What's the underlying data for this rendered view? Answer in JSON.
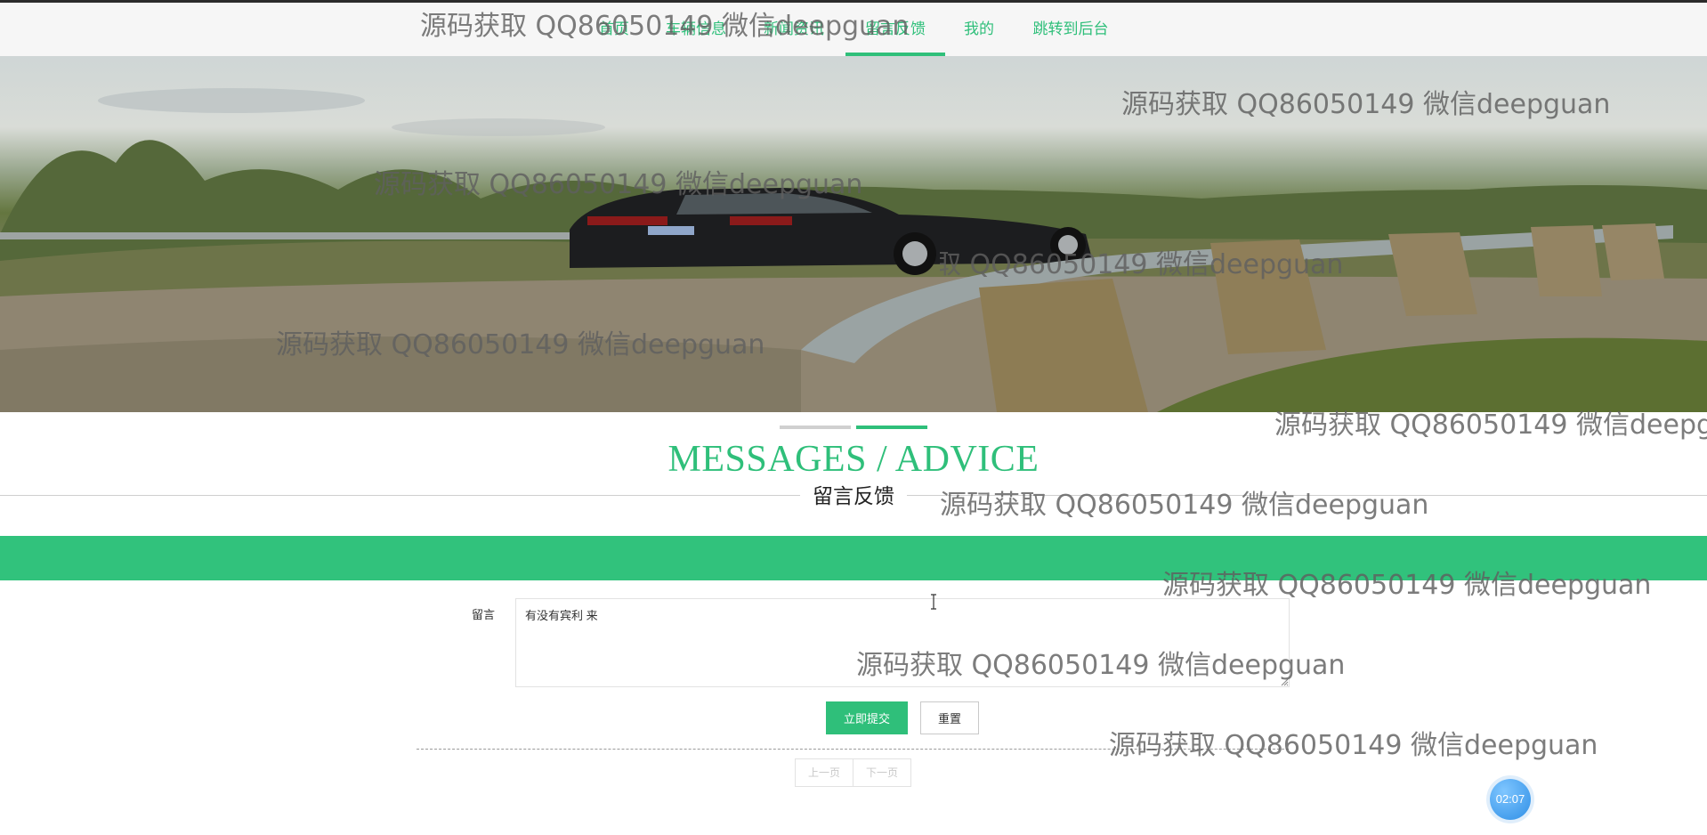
{
  "nav": {
    "items": [
      {
        "label": "首页"
      },
      {
        "label": "车辆信息"
      },
      {
        "label": "新闻资讯"
      },
      {
        "label": "留言反馈",
        "active": true
      },
      {
        "label": "我的"
      },
      {
        "label": "跳转到后台"
      }
    ]
  },
  "banner": {
    "carousel_active_index": 1,
    "carousel_count": 2
  },
  "section": {
    "title": "MESSAGES / ADVICE",
    "subtitle": "留言反馈"
  },
  "form": {
    "message_label": "留言",
    "message_value": "有没有宾利 来",
    "submit_label": "立即提交",
    "reset_label": "重置"
  },
  "pager": {
    "prev_label": "上一页",
    "next_label": "下一页"
  },
  "timer": {
    "text": "02:07"
  },
  "watermark": {
    "text": "源码获取 QQ86050149 微信deepguan"
  },
  "colors": {
    "accent": "#2fbf7a",
    "band": "#31c27c"
  }
}
